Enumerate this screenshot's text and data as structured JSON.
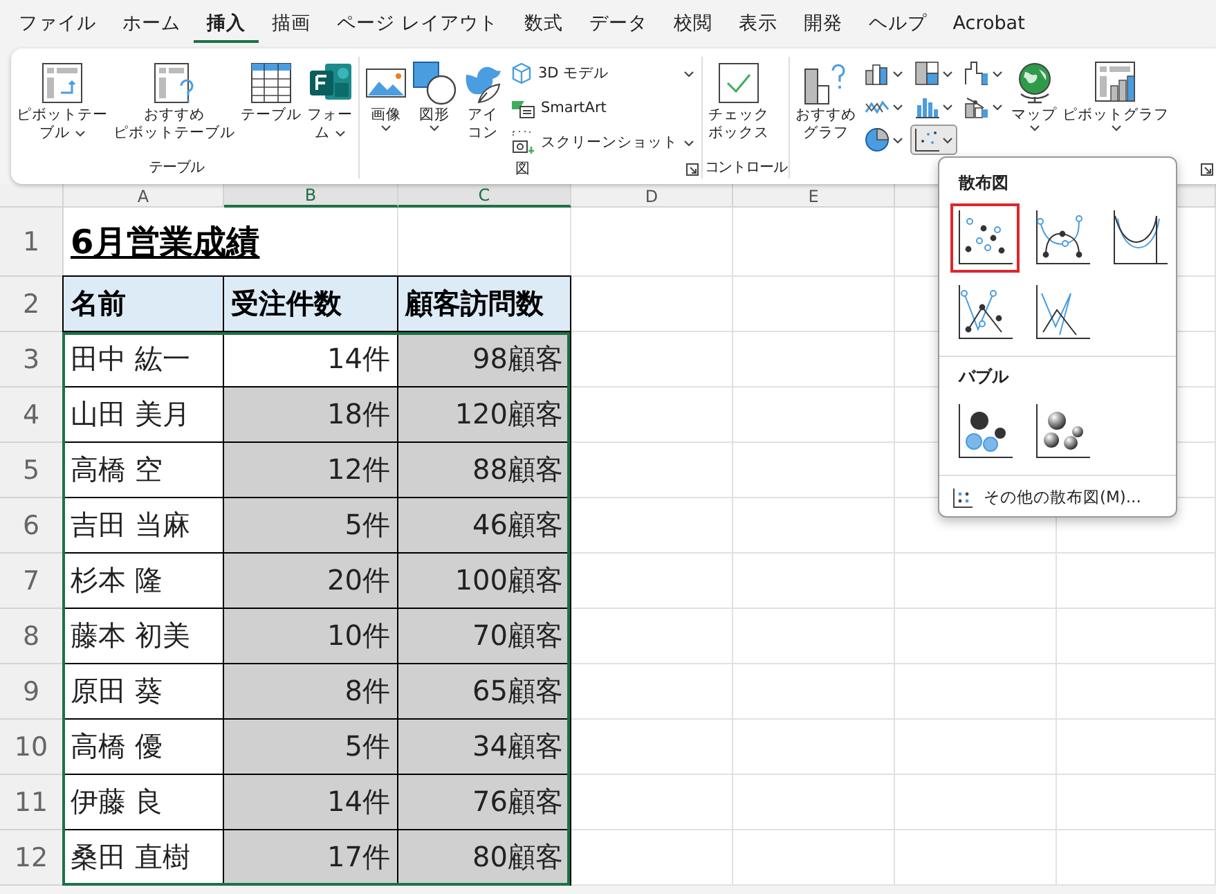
{
  "tabs": [
    {
      "label": "ファイル",
      "selected": false
    },
    {
      "label": "ホーム",
      "selected": false
    },
    {
      "label": "挿入",
      "selected": true
    },
    {
      "label": "描画",
      "selected": false
    },
    {
      "label": "ページ レイアウト",
      "selected": false
    },
    {
      "label": "数式",
      "selected": false
    },
    {
      "label": "データ",
      "selected": false
    },
    {
      "label": "校閲",
      "selected": false
    },
    {
      "label": "表示",
      "selected": false
    },
    {
      "label": "開発",
      "selected": false
    },
    {
      "label": "ヘルプ",
      "selected": false
    },
    {
      "label": "Acrobat",
      "selected": false
    }
  ],
  "ribbon": {
    "groups": [
      {
        "label": "テーブル",
        "items": [
          {
            "kind": "large",
            "lines": [
              "ピボットテー",
              "ブル"
            ],
            "dropdown": true
          },
          {
            "kind": "large",
            "lines": [
              "おすすめ",
              "ピボットテーブル"
            ],
            "dropdown": false
          },
          {
            "kind": "large",
            "lines": [
              "テーブル"
            ],
            "dropdown": false
          },
          {
            "kind": "large",
            "lines": [
              "フォー",
              "ム"
            ],
            "dropdown": true
          }
        ]
      },
      {
        "label": "図",
        "items": [
          {
            "kind": "large",
            "lines": [
              "画像"
            ],
            "dropdown": true
          },
          {
            "kind": "large",
            "lines": [
              "図形"
            ],
            "dropdown": true
          },
          {
            "kind": "large",
            "lines": [
              "アイ",
              "コン"
            ],
            "dropdown": false
          },
          {
            "kind": "small",
            "label": "3D モデル",
            "dropdown": true
          },
          {
            "kind": "small",
            "label": "SmartArt",
            "dropdown": false
          },
          {
            "kind": "small",
            "label": "スクリーンショット",
            "dropdown": true
          }
        ]
      },
      {
        "label": "コントロール",
        "items": [
          {
            "kind": "large",
            "lines": [
              "チェック",
              "ボックス"
            ],
            "dropdown": false
          }
        ]
      },
      {
        "items": [
          {
            "kind": "large",
            "lines": [
              "おすすめ",
              "グラフ"
            ],
            "dropdown": false
          },
          {
            "kind": "chart",
            "expanded": false
          },
          {
            "kind": "chart",
            "expanded": false
          },
          {
            "kind": "chart",
            "expanded": false
          },
          {
            "kind": "chart",
            "expanded": false
          },
          {
            "kind": "chart",
            "expanded": false
          },
          {
            "kind": "chart",
            "expanded": true
          },
          {
            "kind": "chart",
            "expanded": false
          },
          {
            "kind": "chart",
            "expanded": false
          },
          {
            "kind": "large",
            "lines": [
              "マップ"
            ],
            "dropdown": true
          },
          {
            "kind": "large",
            "lines": [
              "ピボットグラフ"
            ],
            "dropdown": true
          }
        ]
      }
    ]
  },
  "sheet": {
    "columns": [
      "A",
      "B",
      "C",
      "D",
      "E"
    ],
    "title": {
      "row": "1",
      "text": "6月営業成績"
    },
    "header": {
      "row": "2",
      "cells": [
        "名前",
        "受注件数",
        "顧客訪問数"
      ]
    },
    "rows": [
      {
        "row": "3",
        "cells": [
          {
            "text": "田中 紘一",
            "selected": false
          },
          {
            "text": "14件",
            "selected": false
          },
          {
            "text": "98顧客",
            "selected": true
          }
        ]
      },
      {
        "row": "4",
        "cells": [
          {
            "text": "山田 美月",
            "selected": false
          },
          {
            "text": "18件",
            "selected": true
          },
          {
            "text": "120顧客",
            "selected": true
          }
        ]
      },
      {
        "row": "5",
        "cells": [
          {
            "text": "高橋 空",
            "selected": false
          },
          {
            "text": "12件",
            "selected": true
          },
          {
            "text": "88顧客",
            "selected": true
          }
        ]
      },
      {
        "row": "6",
        "cells": [
          {
            "text": "吉田 当麻",
            "selected": false
          },
          {
            "text": "5件",
            "selected": true
          },
          {
            "text": "46顧客",
            "selected": true
          }
        ]
      },
      {
        "row": "7",
        "cells": [
          {
            "text": "杉本 隆",
            "selected": false
          },
          {
            "text": "20件",
            "selected": true
          },
          {
            "text": "100顧客",
            "selected": true
          }
        ]
      },
      {
        "row": "8",
        "cells": [
          {
            "text": "藤本 初美",
            "selected": false
          },
          {
            "text": "10件",
            "selected": true
          },
          {
            "text": "70顧客",
            "selected": true
          }
        ]
      },
      {
        "row": "9",
        "cells": [
          {
            "text": "原田 葵",
            "selected": false
          },
          {
            "text": "8件",
            "selected": true
          },
          {
            "text": "65顧客",
            "selected": true
          }
        ]
      },
      {
        "row": "10",
        "cells": [
          {
            "text": "高橋 優",
            "selected": false
          },
          {
            "text": "5件",
            "selected": true
          },
          {
            "text": "34顧客",
            "selected": true
          }
        ]
      },
      {
        "row": "11",
        "cells": [
          {
            "text": "伊藤 良",
            "selected": false
          },
          {
            "text": "14件",
            "selected": true
          },
          {
            "text": "76顧客",
            "selected": true
          }
        ]
      },
      {
        "row": "12",
        "cells": [
          {
            "text": "桑田 直樹",
            "selected": false
          },
          {
            "text": "17件",
            "selected": true
          },
          {
            "text": "80顧客",
            "selected": true
          }
        ]
      }
    ]
  },
  "gallery": {
    "sections": [
      {
        "title": "散布図",
        "options": [
          {
            "selected": true
          },
          {
            "selected": false
          },
          {
            "selected": false
          },
          {
            "selected": false
          },
          {
            "selected": false
          }
        ]
      },
      {
        "title": "バブル",
        "options": [
          {
            "selected": false
          },
          {
            "selected": false
          }
        ]
      }
    ],
    "footer": "その他の散布図(M)..."
  }
}
